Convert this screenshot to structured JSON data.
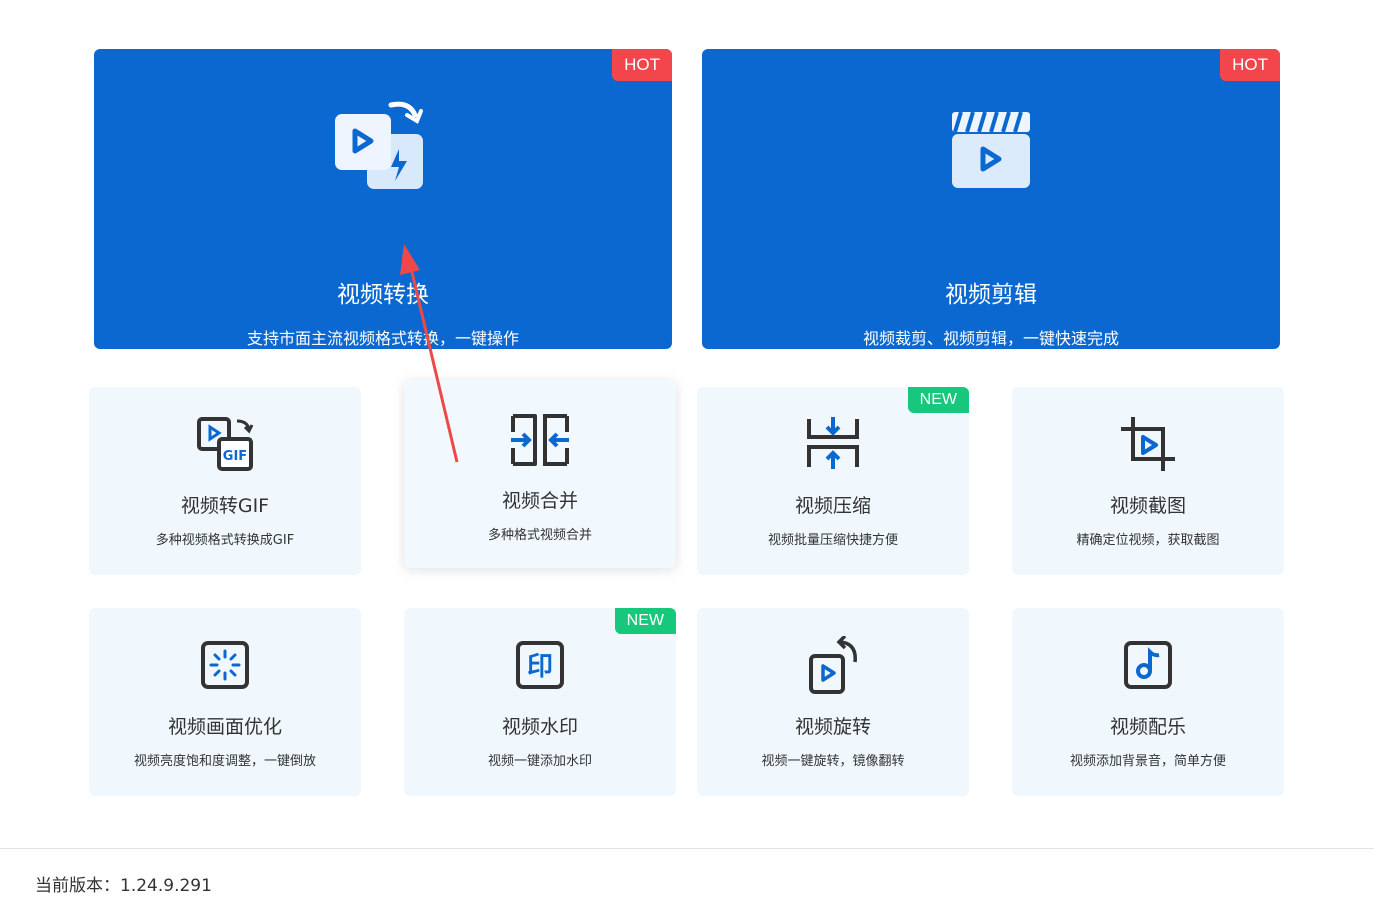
{
  "featured": [
    {
      "title": "视频转换",
      "desc": "支持市面主流视频格式转换，一键操作",
      "badge": "HOT",
      "icon": "video-convert-icon"
    },
    {
      "title": "视频剪辑",
      "desc": "视频裁剪、视频剪辑，一键快速完成",
      "badge": "HOT",
      "icon": "clapperboard-icon"
    }
  ],
  "tools": [
    {
      "title": "视频转GIF",
      "desc": "多种视频格式转换成GIF",
      "icon": "video-to-gif-icon"
    },
    {
      "title": "视频合并",
      "desc": "多种格式视频合并",
      "icon": "merge-icon"
    },
    {
      "title": "视频压缩",
      "desc": "视频批量压缩快捷方便",
      "badge": "NEW",
      "icon": "compress-icon"
    },
    {
      "title": "视频截图",
      "desc": "精确定位视频，获取截图",
      "icon": "crop-icon"
    },
    {
      "title": "视频画面优化",
      "desc": "视频亮度饱和度调整，一键倒放",
      "icon": "enhance-icon"
    },
    {
      "title": "视频水印",
      "desc": "视频一键添加水印",
      "badge": "NEW",
      "icon": "watermark-icon"
    },
    {
      "title": "视频旋转",
      "desc": "视频一键旋转，镜像翻转",
      "icon": "rotate-icon"
    },
    {
      "title": "视频配乐",
      "desc": "视频添加背景音，简单方便",
      "icon": "music-icon"
    }
  ],
  "footer": {
    "version": "当前版本：1.24.9.291"
  },
  "colors": {
    "primary": "#0a68d0",
    "hot": "#f3454c",
    "new": "#17c87c",
    "card_bg": "#f0f8fe"
  }
}
